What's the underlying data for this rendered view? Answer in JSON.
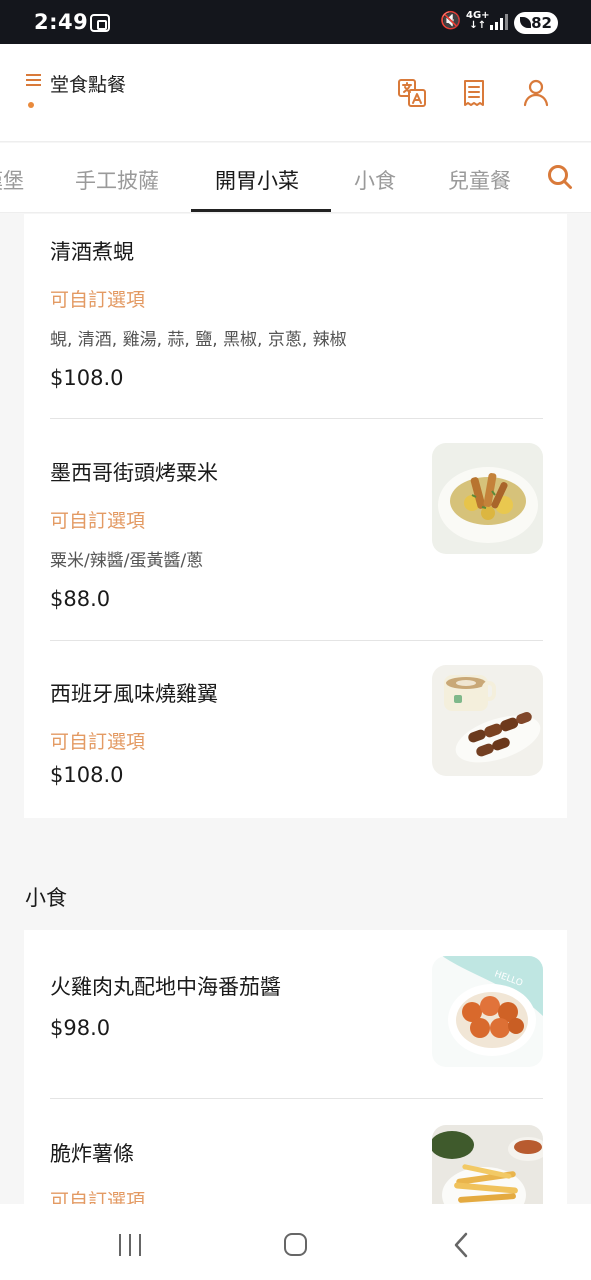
{
  "status_bar": {
    "time": "2:49",
    "network_top": "4G+",
    "network_bottom": "↓↑",
    "battery": "82"
  },
  "header": {
    "title": "堂食點餐",
    "icons": [
      "menu-icon",
      "translate-icon",
      "receipt-icon",
      "user-icon"
    ],
    "accent_color": "#d97a3a"
  },
  "tabs": [
    {
      "label": "漢堡",
      "active": false
    },
    {
      "label": "手工披薩",
      "active": false
    },
    {
      "label": "開胃小菜",
      "active": true
    },
    {
      "label": "小食",
      "active": false
    },
    {
      "label": "兒童餐",
      "active": false
    }
  ],
  "sections": [
    {
      "title": "",
      "items": [
        {
          "name": "清酒煮蜆",
          "option": "可自訂選項",
          "description": "蜆, 清酒, 雞湯, 蒜, 鹽, 黑椒, 京蔥, 辣椒",
          "price": "$108.0",
          "image": "none"
        },
        {
          "name": "墨西哥街頭烤粟米",
          "option": "可自訂選項",
          "description": "粟米/辣醬/蛋黃醬/蔥",
          "price": "$88.0",
          "image": "grilled-corn-photo"
        },
        {
          "name": "西班牙風味燒雞翼",
          "option": "可自訂選項",
          "description": "",
          "price": "$108.0",
          "image": "chicken-wings-photo"
        }
      ]
    },
    {
      "title": "小食",
      "items": [
        {
          "name": "火雞肉丸配地中海番茄醬",
          "option": "",
          "description": "",
          "price": "$98.0",
          "image": "meatballs-photo"
        },
        {
          "name": "脆炸薯條",
          "option": "可自訂選項",
          "description": "",
          "price": "",
          "image": "fries-photo"
        }
      ]
    }
  ],
  "nav_bar": {
    "icons": [
      "recents-icon",
      "home-icon",
      "back-icon"
    ]
  }
}
